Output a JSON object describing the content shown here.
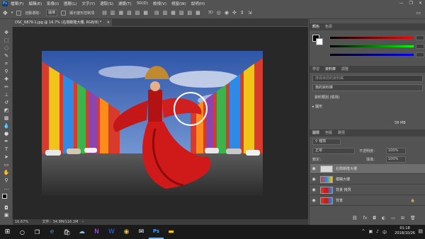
{
  "menu": {
    "app_logo": "Ps",
    "items": [
      "檔案(F)",
      "編輯(E)",
      "影像(I)",
      "圖層(L)",
      "文字(Y)",
      "選取(S)",
      "濾鏡(T)",
      "3D(D)",
      "檢視(V)",
      "視窗(W)",
      "說明(H)"
    ]
  },
  "options": {
    "auto_select_label": "自動選取：",
    "auto_select_value": "圖層",
    "show_transform_label": "顯示變形控制項"
  },
  "document": {
    "tab_title": "DSC_6879.1.jpg @ 16.7% (右側斯隆大樓, RGB/8) *",
    "status_zoom": "16.67%",
    "status_doc": "文件：34.9M/116.2M"
  },
  "panels": {
    "color_tabs": [
      "顏色",
      "色票"
    ],
    "learn_tabs": [
      "學習",
      "資料庫",
      "調整"
    ],
    "library_search_placeholder": "搜尋目前的資料庫",
    "library_name": "我的資料庫",
    "library_section": "資料類別 (檢視)",
    "library_item": "圖形",
    "library_size": "58 MB",
    "layers_tabs": [
      "圖層",
      "色版",
      "路徑"
    ],
    "filter_kind": "種類",
    "blend_mode": "正常",
    "opacity_label": "不透明度：",
    "opacity_value": "100%",
    "lock_label": "鎖定：",
    "fill_label": "填滿：",
    "fill_value": "100%",
    "layers": [
      {
        "name": "右側斯隆大樓",
        "selected": true
      },
      {
        "name": "模糊大樓",
        "selected": false
      },
      {
        "name": "背景 拷貝",
        "selected": false
      },
      {
        "name": "背景",
        "selected": false,
        "locked": true
      }
    ]
  },
  "taskbar": {
    "time": "01:18",
    "date": "2018/10/26",
    "ime": "中",
    "apps": [
      "windows-start",
      "search",
      "task-view",
      "edge",
      "store",
      "onedrive",
      "onenote",
      "word",
      "chrome",
      "mail",
      "photoshop",
      "file-explorer"
    ]
  }
}
